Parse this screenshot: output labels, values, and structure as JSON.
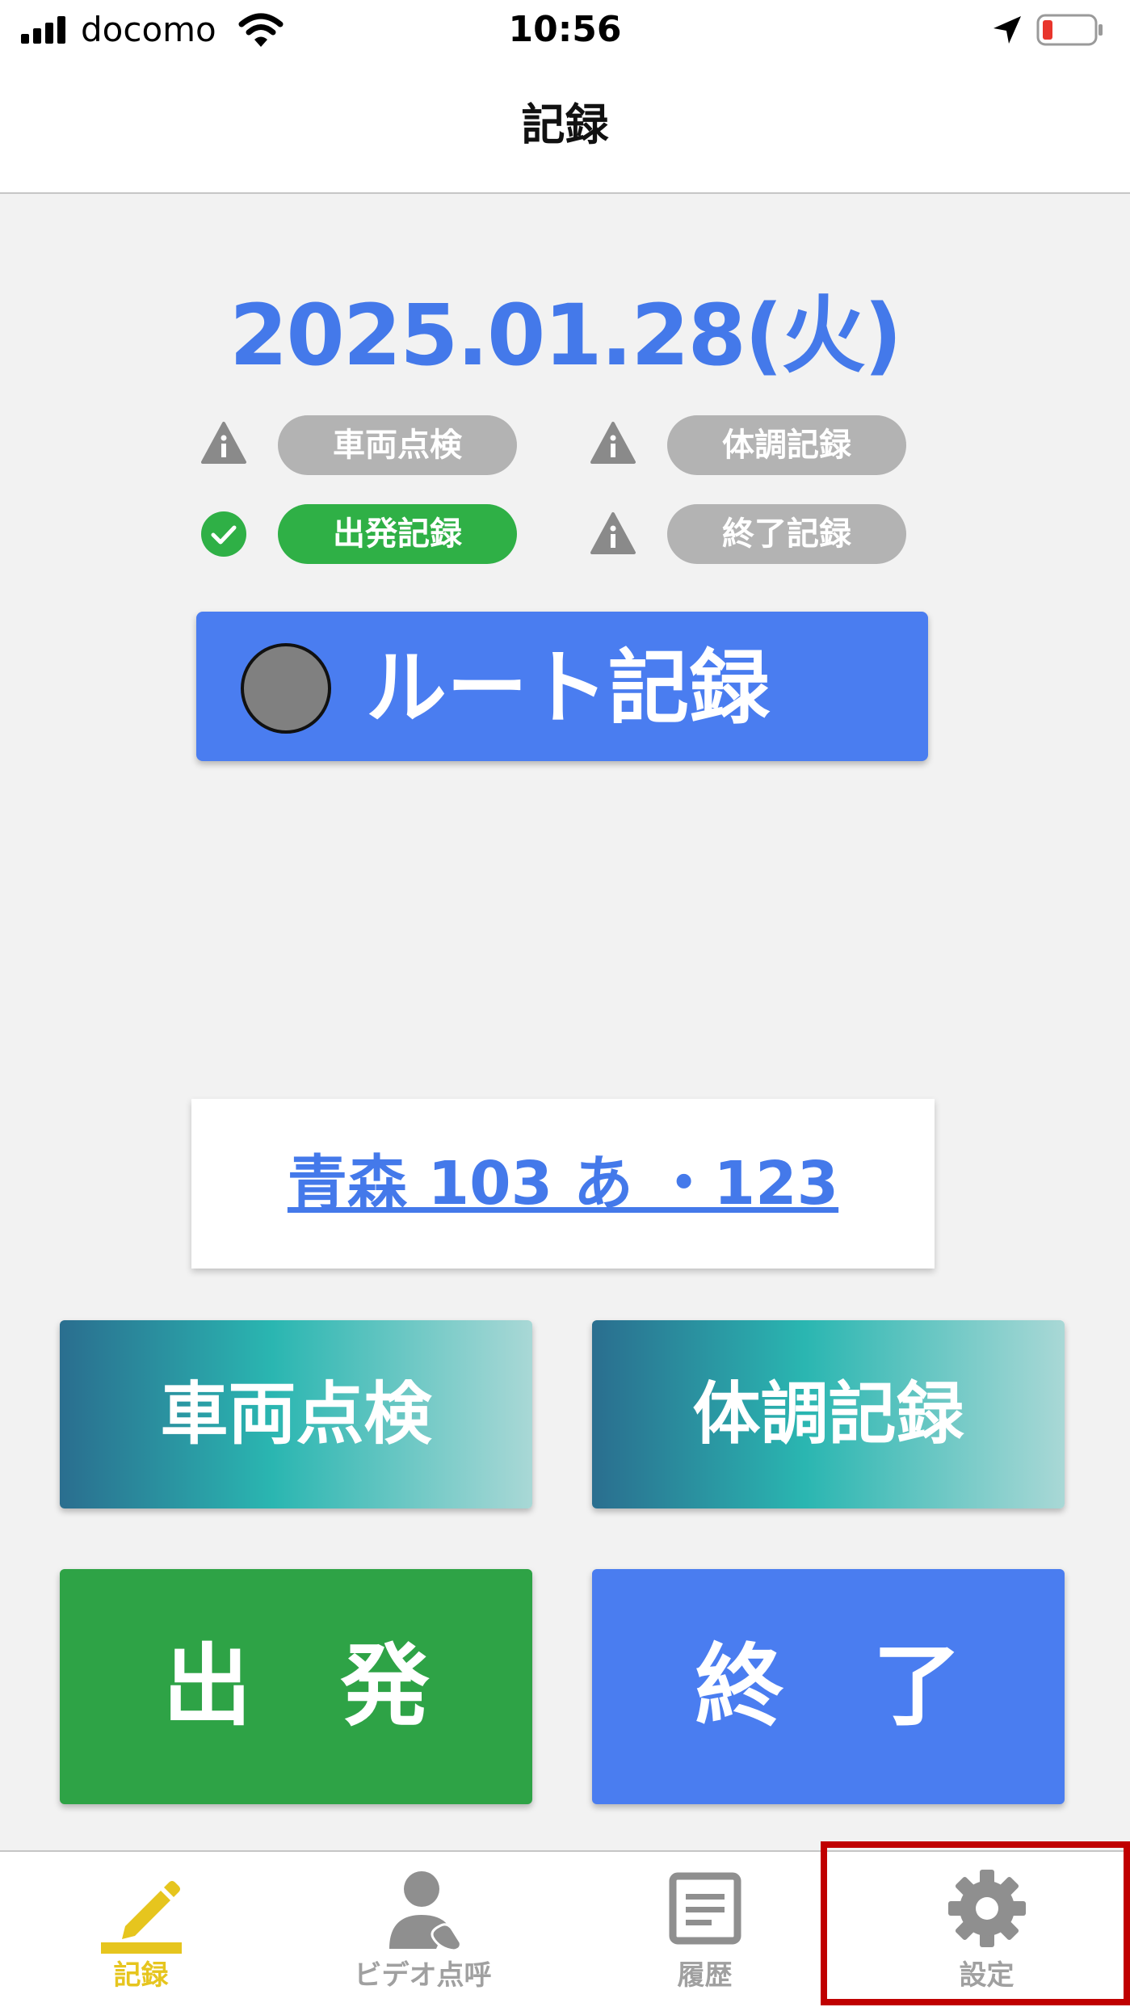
{
  "status_bar": {
    "carrier": "docomo",
    "time": "10:56"
  },
  "header": {
    "title": "記録"
  },
  "date": "2025.01.28(火)",
  "record_status": [
    {
      "label": "車両点検",
      "state": "warning"
    },
    {
      "label": "体調記録",
      "state": "warning"
    },
    {
      "label": "出発記録",
      "state": "done"
    },
    {
      "label": "終了記録",
      "state": "warning"
    }
  ],
  "route_button": {
    "label": "ルート記録"
  },
  "vehicle": {
    "plate": "青森 103 あ ・123"
  },
  "actions": {
    "vehicle_check": "車両点検",
    "health_record": "体調記録",
    "depart": "出　発",
    "finish": "終　了"
  },
  "tab_bar": {
    "items": [
      {
        "label": "記録",
        "icon": "pencil-icon",
        "active": true
      },
      {
        "label": "ビデオ点呼",
        "icon": "person-phone-icon",
        "active": false
      },
      {
        "label": "履歴",
        "icon": "history-icon",
        "active": false
      },
      {
        "label": "設定",
        "icon": "gear-icon",
        "active": false
      }
    ]
  },
  "colors": {
    "accent_blue": "#4479ea",
    "done_green": "#2fb046",
    "pending_gray": "#b3b3b3",
    "active_tab": "#e6c51e",
    "highlight_red": "#c00000"
  }
}
